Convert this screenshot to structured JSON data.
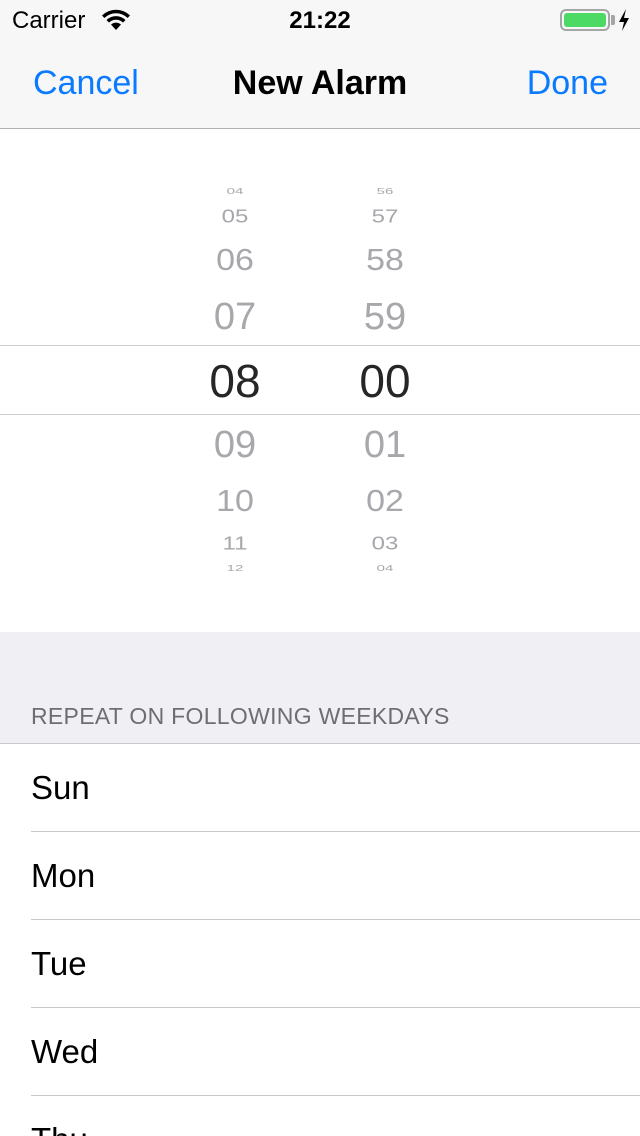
{
  "status_bar": {
    "carrier": "Carrier",
    "time": "21:22",
    "battery_color": "#4cd964",
    "icons": [
      "wifi-icon",
      "battery-icon",
      "charging-bolt-icon"
    ]
  },
  "nav": {
    "cancel_label": "Cancel",
    "title": "New Alarm",
    "done_label": "Done",
    "tint_color": "#0a7aff"
  },
  "picker": {
    "hours": [
      "04",
      "05",
      "06",
      "07",
      "08",
      "09",
      "10",
      "11",
      "12"
    ],
    "minutes": [
      "56",
      "57",
      "58",
      "59",
      "00",
      "01",
      "02",
      "03",
      "04"
    ],
    "selected_hour": "08",
    "selected_minute": "00"
  },
  "repeat_section": {
    "header": "REPEAT ON FOLLOWING WEEKDAYS",
    "days": [
      "Sun",
      "Mon",
      "Tue",
      "Wed",
      "Thu"
    ]
  }
}
